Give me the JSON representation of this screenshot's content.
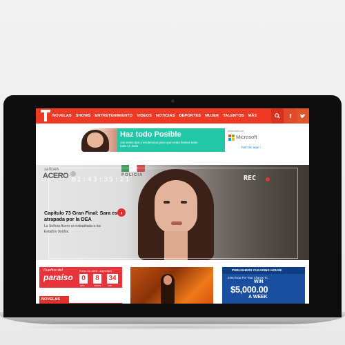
{
  "nav": {
    "logo_label": "T",
    "items": [
      "NOVELAS",
      "SHOWS",
      "ENTRETENIMIENTO",
      "VIDEOS",
      "NOTICIAS",
      "DEPORTES",
      "MUJER",
      "TALENTOS",
      "MÁS"
    ],
    "search_icon": "🔍",
    "facebook_icon": "f",
    "twitter_icon": "🐦"
  },
  "ad": {
    "headline": "Haz todo Posible",
    "subtext": "con estos tips y tendencias para que estas fiestas sean todo un éxito",
    "presented": "presentado por",
    "brand": "Microsoft",
    "cta": "haz clic aquí ›",
    "ms_colors": [
      "#f25022",
      "#7fba00",
      "#00a4ef",
      "#ffb900"
    ]
  },
  "hero": {
    "brand_small": "SEÑORA",
    "brand_large": "ACERO",
    "timecode": "01:43:39:21",
    "rec": "REC",
    "sign": "POLICIA",
    "title": "Capítulo 73 Gran Final: Sara es atrapada por la DEA",
    "description": "La Señora Acero es extraditada a los Estados Unidos.",
    "next_arrow": "›"
  },
  "cards": {
    "countdown": {
      "show_small": "Dueños del",
      "show_large": "paraíso",
      "date": "Enero 13, 2015 - 10pm/9pm",
      "days": "0",
      "hours": "8",
      "minutes": "34",
      "label_days": "DÍAS",
      "label_hours": "HORAS",
      "label_minutes": "MIN"
    },
    "category": "NOVELAS",
    "promo": {
      "header": "PUBLISHERS CLEARING HOUSE",
      "enter": "Enter Now For Your Chance To",
      "win": "WIN",
      "amount": "$5,000.00",
      "week": "A WEEK"
    }
  }
}
